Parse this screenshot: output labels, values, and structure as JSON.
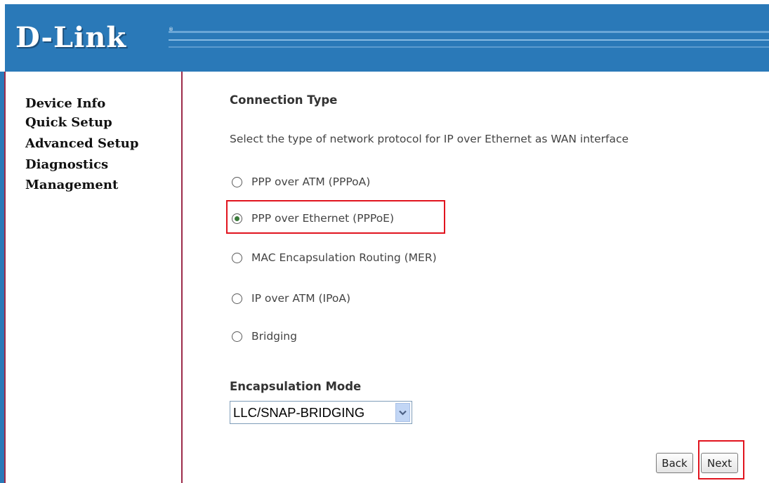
{
  "brand": {
    "logo_text": "D-Link",
    "header_color": "#2a79b8"
  },
  "sidebar": {
    "items": [
      {
        "label": "Device Info"
      },
      {
        "label": "Quick Setup"
      },
      {
        "label": "Advanced Setup"
      },
      {
        "label": "Diagnostics"
      },
      {
        "label": "Management"
      }
    ]
  },
  "main": {
    "title": "Connection Type",
    "description": "Select the type of network protocol for IP over Ethernet as WAN interface",
    "options": [
      {
        "label": "PPP over ATM (PPPoA)",
        "checked": false
      },
      {
        "label": "PPP over Ethernet (PPPoE)",
        "checked": true
      },
      {
        "label": "MAC Encapsulation Routing (MER)",
        "checked": false
      },
      {
        "label": "IP over ATM (IPoA)",
        "checked": false
      },
      {
        "label": "Bridging",
        "checked": false
      }
    ],
    "encapsulation": {
      "label": "Encapsulation Mode",
      "selected": "LLC/SNAP-BRIDGING"
    },
    "buttons": {
      "back": "Back",
      "next": "Next"
    }
  },
  "highlight_color": "#e1141e"
}
